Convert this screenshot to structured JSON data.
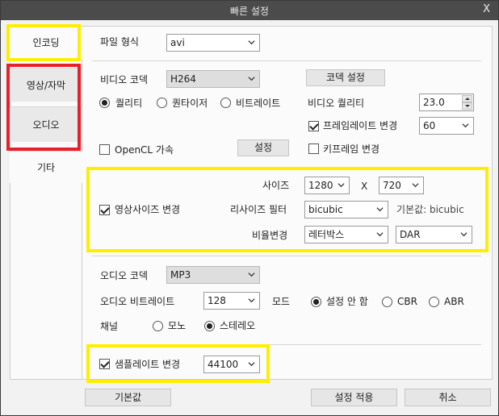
{
  "window": {
    "title": "빠른 설정",
    "close_glyph": "X"
  },
  "tabs": [
    {
      "label": "인코딩"
    },
    {
      "label": "영상/자막"
    },
    {
      "label": "오디오"
    },
    {
      "label": "기타"
    }
  ],
  "file_format": {
    "label": "파일 형식",
    "value": "avi"
  },
  "video": {
    "codec_label": "비디오 코덱",
    "codec_value": "H264",
    "codec_settings_button": "코덱 설정",
    "mode_options": [
      "퀄리티",
      "퀀타이저",
      "비트레이트"
    ],
    "mode_selected": "퀄리티",
    "quality_label": "비디오 퀄리티",
    "quality_value": "23.0",
    "framerate_change_label": "프레임레이트 변경",
    "framerate_change_checked": true,
    "framerate_value": "60",
    "opencl_label": "OpenCL 가속",
    "opencl_checked": false,
    "opencl_settings_button": "설정",
    "keyframe_change_label": "키프레임 변경",
    "keyframe_change_checked": false
  },
  "resize": {
    "change_label": "영상사이즈 변경",
    "change_checked": true,
    "size_label": "사이즈",
    "width": "1280",
    "x_label": "X",
    "height": "720",
    "filter_label": "리사이즈 필터",
    "filter_value": "bicubic",
    "filter_default": "기본값: bicubic",
    "aspect_label": "비율변경",
    "aspect_value": "레터박스",
    "aspect_mode": "DAR"
  },
  "audio": {
    "codec_label": "오디오 코덱",
    "codec_value": "MP3",
    "bitrate_label": "오디오 비트레이트",
    "bitrate_value": "128",
    "mode_label": "모드",
    "mode_options": [
      "설정 안 함",
      "CBR",
      "ABR"
    ],
    "mode_selected": "설정 안 함",
    "channel_label": "채널",
    "channel_options": [
      "모노",
      "스테레오"
    ],
    "channel_selected": "스테레오",
    "samplerate_change_label": "샘플레이트 변경",
    "samplerate_change_checked": true,
    "samplerate_value": "44100"
  },
  "footer": {
    "default_button": "기본값",
    "apply_button": "설정 적용",
    "cancel_button": "취소"
  },
  "highlight_colors": {
    "yellow": "#ffee00",
    "red": "#e8202a"
  }
}
